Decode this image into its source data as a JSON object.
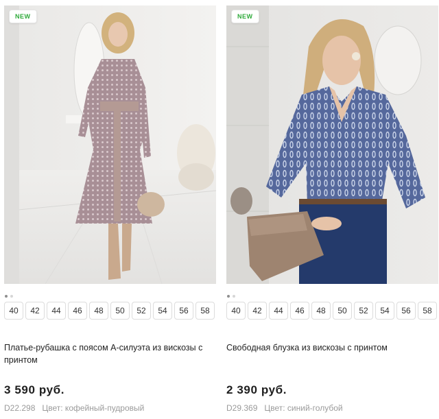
{
  "products": [
    {
      "badge": "NEW",
      "title": "Платье-рубашка с поясом А-силуэта из вискозы с принтом",
      "price": "3 590 руб.",
      "sku": "D22.298",
      "color": "Цвет: кофейный-пудровый",
      "sizes": [
        "40",
        "42",
        "44",
        "46",
        "48",
        "50",
        "52",
        "54",
        "56",
        "58"
      ],
      "slides_total": 2,
      "slide_active": 1
    },
    {
      "badge": "NEW",
      "title": "Свободная блузка из вискозы с принтом",
      "price": "2 390 руб.",
      "sku": "D29.369",
      "color": "Цвет: синий-голубой",
      "sizes": [
        "40",
        "42",
        "44",
        "46",
        "48",
        "50",
        "52",
        "54",
        "56",
        "58"
      ],
      "slides_total": 2,
      "slide_active": 1
    }
  ]
}
